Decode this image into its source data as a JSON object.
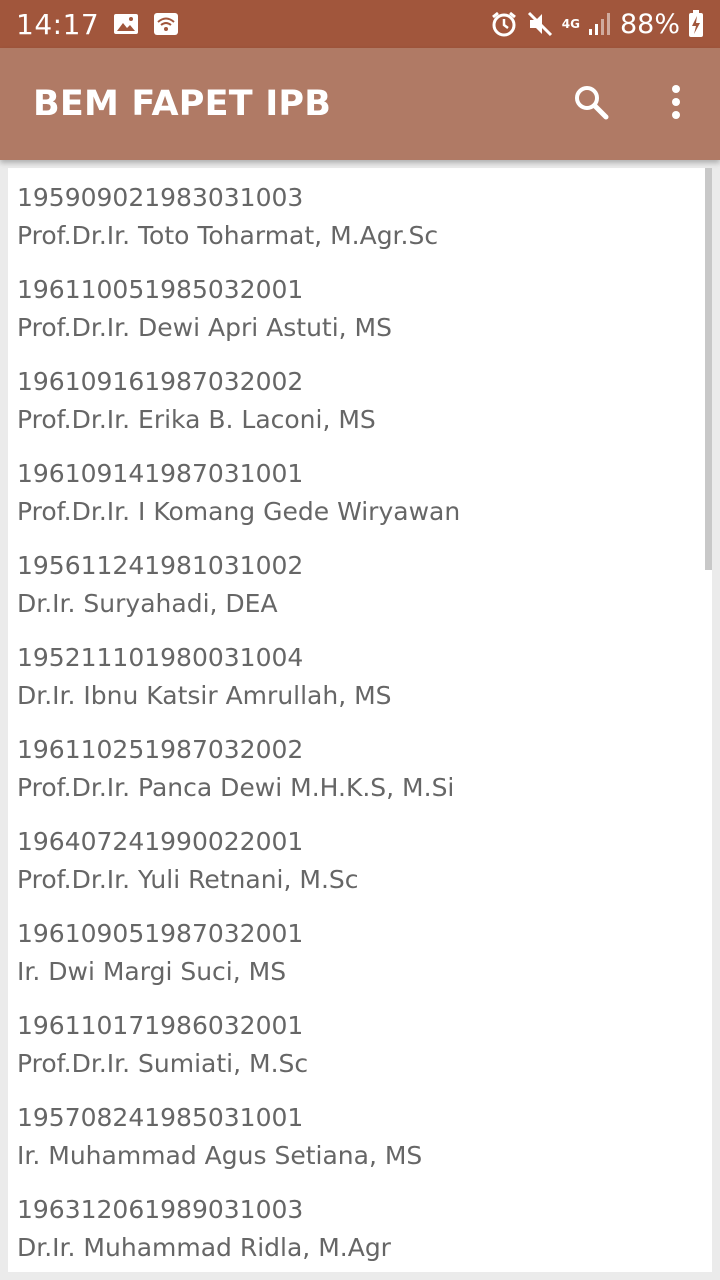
{
  "status_bar": {
    "time": "14:17",
    "network_label": "4G",
    "battery": "88%",
    "left_icons": [
      "image-icon",
      "wifi-icon"
    ],
    "right_icons": [
      "alarm-icon",
      "mute-icon",
      "signal-icon",
      "battery-icon"
    ]
  },
  "app_bar": {
    "title": "BEM FAPET IPB",
    "actions": [
      "search-icon",
      "more-vert-icon"
    ]
  },
  "lecturers": [
    {
      "nip": "195909021983031003",
      "name": "Prof.Dr.Ir. Toto Toharmat, M.Agr.Sc"
    },
    {
      "nip": "196110051985032001",
      "name": "Prof.Dr.Ir. Dewi Apri Astuti, MS"
    },
    {
      "nip": "196109161987032002",
      "name": "Prof.Dr.Ir. Erika B. Laconi, MS"
    },
    {
      "nip": "196109141987031001",
      "name": "Prof.Dr.Ir. I Komang Gede Wiryawan"
    },
    {
      "nip": "195611241981031002",
      "name": "Dr.Ir. Suryahadi, DEA"
    },
    {
      "nip": "195211101980031004",
      "name": "Dr.Ir. Ibnu Katsir Amrullah, MS"
    },
    {
      "nip": "196110251987032002",
      "name": "Prof.Dr.Ir. Panca Dewi M.H.K.S, M.Si"
    },
    {
      "nip": "196407241990022001",
      "name": "Prof.Dr.Ir. Yuli Retnani, M.Sc"
    },
    {
      "nip": "196109051987032001",
      "name": "Ir. Dwi Margi Suci, MS"
    },
    {
      "nip": "196110171986032001",
      "name": "Prof.Dr.Ir. Sumiati, M.Sc"
    },
    {
      "nip": "195708241985031001",
      "name": "Ir. Muhammad Agus Setiana, MS"
    },
    {
      "nip": "196312061989031003",
      "name": "Dr.Ir. Muhammad Ridla, M.Agr"
    }
  ],
  "colors": {
    "status_bar": "#a1563c",
    "app_bar": "#b07a65",
    "list_text": "#666666"
  }
}
